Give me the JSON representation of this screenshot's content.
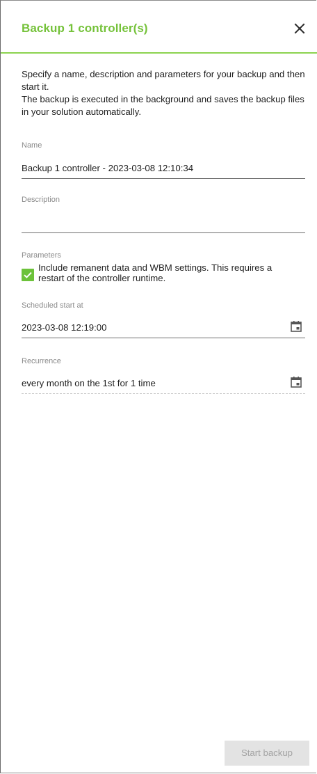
{
  "dialog": {
    "title": "Backup 1 controller(s)",
    "close_icon": "close-icon"
  },
  "intro": {
    "line1": "Specify a name, description and parameters for your backup and then start it.",
    "line2": "The backup is executed in the background and saves the backup files in your solution automatically."
  },
  "name": {
    "label": "Name",
    "value": "Backup 1 controller - 2023-03-08 12:10:34"
  },
  "description": {
    "label": "Description",
    "value": ""
  },
  "parameters": {
    "label": "Parameters",
    "checkbox_label": "Include remanent data and WBM settings. This requires a restart of the controller runtime.",
    "checked": true
  },
  "schedule": {
    "label": "Scheduled start at",
    "value": "2023-03-08 12:19:00",
    "icon": "calendar-icon"
  },
  "recurrence": {
    "label": "Recurrence",
    "value": "every month on the 1st for 1 time",
    "icon": "calendar-icon"
  },
  "footer": {
    "start_label": "Start backup",
    "disabled": true
  },
  "colors": {
    "accent": "#75c23a",
    "checkbox": "#6cc23a",
    "header_rule": "#8cd34f"
  }
}
